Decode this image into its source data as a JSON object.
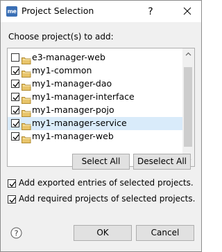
{
  "window": {
    "app_icon_text": "me",
    "title": "Project Selection"
  },
  "dialog": {
    "prompt": "Choose project(s) to add:",
    "projects": [
      {
        "name": "e3-manager-web",
        "checked": false,
        "selected": false
      },
      {
        "name": "my1-common",
        "checked": true,
        "selected": false
      },
      {
        "name": "my1-manager-dao",
        "checked": true,
        "selected": false
      },
      {
        "name": "my1-manager-interface",
        "checked": true,
        "selected": false
      },
      {
        "name": "my1-manager-pojo",
        "checked": true,
        "selected": false
      },
      {
        "name": "my1-manager-service",
        "checked": true,
        "selected": true
      },
      {
        "name": "my1-manager-web",
        "checked": true,
        "selected": false
      }
    ],
    "select_all_label": "Select All",
    "deselect_all_label": "Deselect All",
    "option_exported": "Add exported entries of selected projects.",
    "option_exported_checked": true,
    "option_required": "Add required projects of selected projects.",
    "option_required_checked": true,
    "ok_label": "OK",
    "cancel_label": "Cancel"
  },
  "colors": {
    "selection": "#d9ebfa",
    "folder": "#e8c46a",
    "button_bg": "#e1e1e1"
  }
}
